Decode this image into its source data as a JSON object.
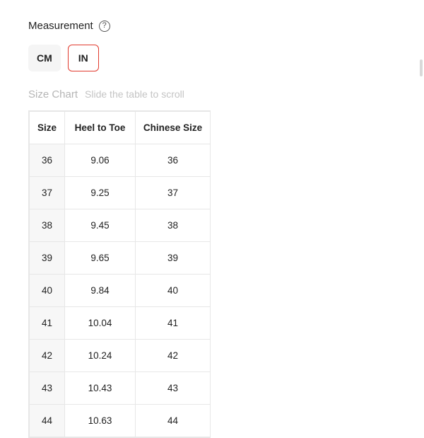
{
  "measurement": {
    "label": "Measurement",
    "help_icon": "?"
  },
  "units": {
    "cm_label": "CM",
    "in_label": "IN",
    "active": "IN"
  },
  "sizechart": {
    "label": "Size Chart",
    "hint": "Slide the table to scroll"
  },
  "table": {
    "headers": [
      "Size",
      "Heel to Toe",
      "Chinese Size"
    ],
    "rows": [
      {
        "size": "36",
        "heel_to_toe": "9.06",
        "chinese_size": "36"
      },
      {
        "size": "37",
        "heel_to_toe": "9.25",
        "chinese_size": "37"
      },
      {
        "size": "38",
        "heel_to_toe": "9.45",
        "chinese_size": "38"
      },
      {
        "size": "39",
        "heel_to_toe": "9.65",
        "chinese_size": "39"
      },
      {
        "size": "40",
        "heel_to_toe": "9.84",
        "chinese_size": "40"
      },
      {
        "size": "41",
        "heel_to_toe": "10.04",
        "chinese_size": "41"
      },
      {
        "size": "42",
        "heel_to_toe": "10.24",
        "chinese_size": "42"
      },
      {
        "size": "43",
        "heel_to_toe": "10.43",
        "chinese_size": "43"
      },
      {
        "size": "44",
        "heel_to_toe": "10.63",
        "chinese_size": "44"
      }
    ]
  }
}
